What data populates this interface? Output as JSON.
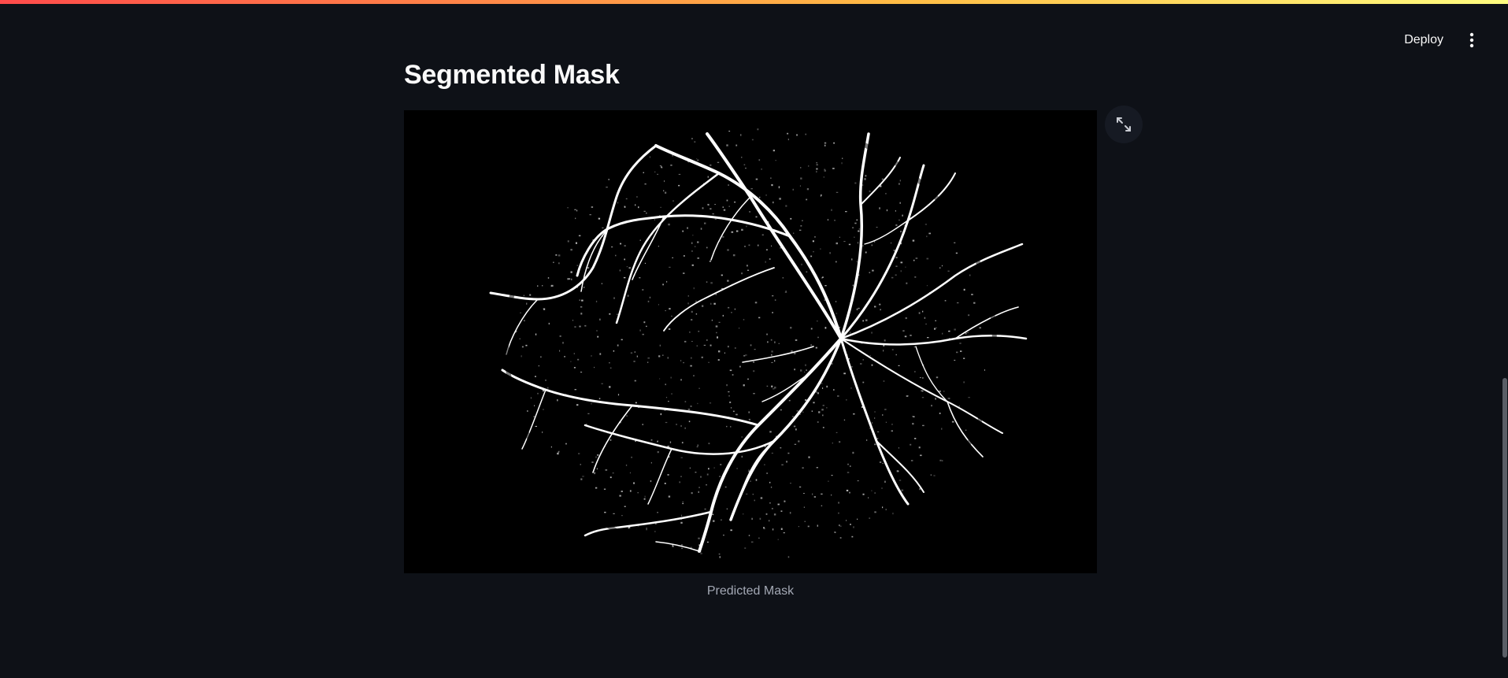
{
  "header": {
    "deploy_label": "Deploy",
    "menu_icon": "vertical-dots-icon"
  },
  "main": {
    "title": "Segmented Mask",
    "image": {
      "alt": "Predicted Mask",
      "caption": "Predicted Mask"
    },
    "fullscreen_icon": "expand-arrows-icon"
  },
  "colors": {
    "background": "#0e1117",
    "accent_gradient": [
      "#ff4b4b",
      "#ffbd45",
      "#fffd80"
    ],
    "vessel": "#ffffff",
    "image_background": "#000000"
  }
}
